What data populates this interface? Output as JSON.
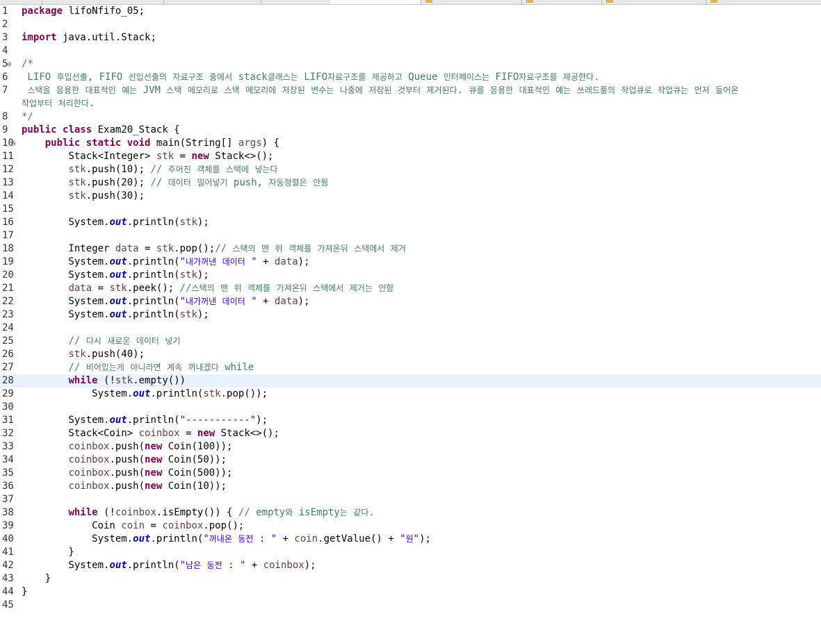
{
  "editor": {
    "current_line": 28,
    "lines": [
      {
        "n": "1",
        "t": "package lifoNfifo_05;"
      },
      {
        "n": "2",
        "t": ""
      },
      {
        "n": "3",
        "t": "import java.util.Stack;"
      },
      {
        "n": "4",
        "t": ""
      },
      {
        "n": "5",
        "t": "/*",
        "fold": true
      },
      {
        "n": "6",
        "t": " LIFO 후입선출, FIFO 선입선출의 자료구조 중에서 stack클래스는 LIFO자료구조를 제공하고 Queue 인터페이스는 FIFO자료구조를 제공한다."
      },
      {
        "n": "7",
        "t": " 스택을 응용한 대표적인 예는 JVM 스택 메모리로 스택 메모리에 저장된 변수는 나중에 저장된 것부터 제거된다. 큐를 응용한 대표적인 예는 쓰레드풀의 작업큐로 작업큐는 먼저 들어온"
      },
      {
        "n": "",
        "t": "작업부터 처리한다."
      },
      {
        "n": "8",
        "t": "*/"
      },
      {
        "n": "9",
        "t": "public class Exam20_Stack {"
      },
      {
        "n": "10",
        "t": "    public static void main(String[] args) {",
        "fold": true
      },
      {
        "n": "11",
        "t": "        Stack<Integer> stk = new Stack<>();"
      },
      {
        "n": "12",
        "t": "        stk.push(10); // 주어진 객체를 스택에 넣는다"
      },
      {
        "n": "13",
        "t": "        stk.push(20); // 데이터 밀어넣기 push, 자동정렬은 안됨"
      },
      {
        "n": "14",
        "t": "        stk.push(30);"
      },
      {
        "n": "15",
        "t": ""
      },
      {
        "n": "16",
        "t": "        System.out.println(stk);"
      },
      {
        "n": "17",
        "t": ""
      },
      {
        "n": "18",
        "t": "        Integer data = stk.pop();// 스택의 맨 위 객체를 가져온뒤 스택에서 제거"
      },
      {
        "n": "19",
        "t": "        System.out.println(\"내가꺼낸 데이터 \" + data);"
      },
      {
        "n": "20",
        "t": "        System.out.println(stk);"
      },
      {
        "n": "21",
        "t": "        data = stk.peek(); //스택의 맨 위 객체를 가져온뒤 스택에서 제거는 안함"
      },
      {
        "n": "22",
        "t": "        System.out.println(\"내가꺼낸 데이터 \" + data);"
      },
      {
        "n": "23",
        "t": "        System.out.println(stk);"
      },
      {
        "n": "24",
        "t": ""
      },
      {
        "n": "25",
        "t": "        // 다시 새로운 데이터 넣기"
      },
      {
        "n": "26",
        "t": "        stk.push(40);"
      },
      {
        "n": "27",
        "t": "        // 비어있는게 아니라면 계속 꺼내겠다 while"
      },
      {
        "n": "28",
        "t": "        while (!stk.empty())"
      },
      {
        "n": "29",
        "t": "            System.out.println(stk.pop());"
      },
      {
        "n": "30",
        "t": ""
      },
      {
        "n": "31",
        "t": "        System.out.println(\"-----------\");"
      },
      {
        "n": "32",
        "t": "        Stack<Coin> coinbox = new Stack<>();"
      },
      {
        "n": "33",
        "t": "        coinbox.push(new Coin(100));"
      },
      {
        "n": "34",
        "t": "        coinbox.push(new Coin(50));"
      },
      {
        "n": "35",
        "t": "        coinbox.push(new Coin(500));"
      },
      {
        "n": "36",
        "t": "        coinbox.push(new Coin(10));"
      },
      {
        "n": "37",
        "t": ""
      },
      {
        "n": "38",
        "t": "        while (!coinbox.isEmpty()) { // empty와 isEmpty는 같다."
      },
      {
        "n": "39",
        "t": "            Coin coin = coinbox.pop();"
      },
      {
        "n": "40",
        "t": "            System.out.println(\"꺼내온 동전 : \" + coin.getValue() + \"원\");"
      },
      {
        "n": "41",
        "t": "        }"
      },
      {
        "n": "42",
        "t": "        System.out.println(\"남은 동전 : \" + coinbox);"
      },
      {
        "n": "43",
        "t": "    }"
      },
      {
        "n": "44",
        "t": "}"
      },
      {
        "n": "45",
        "t": ""
      }
    ]
  }
}
